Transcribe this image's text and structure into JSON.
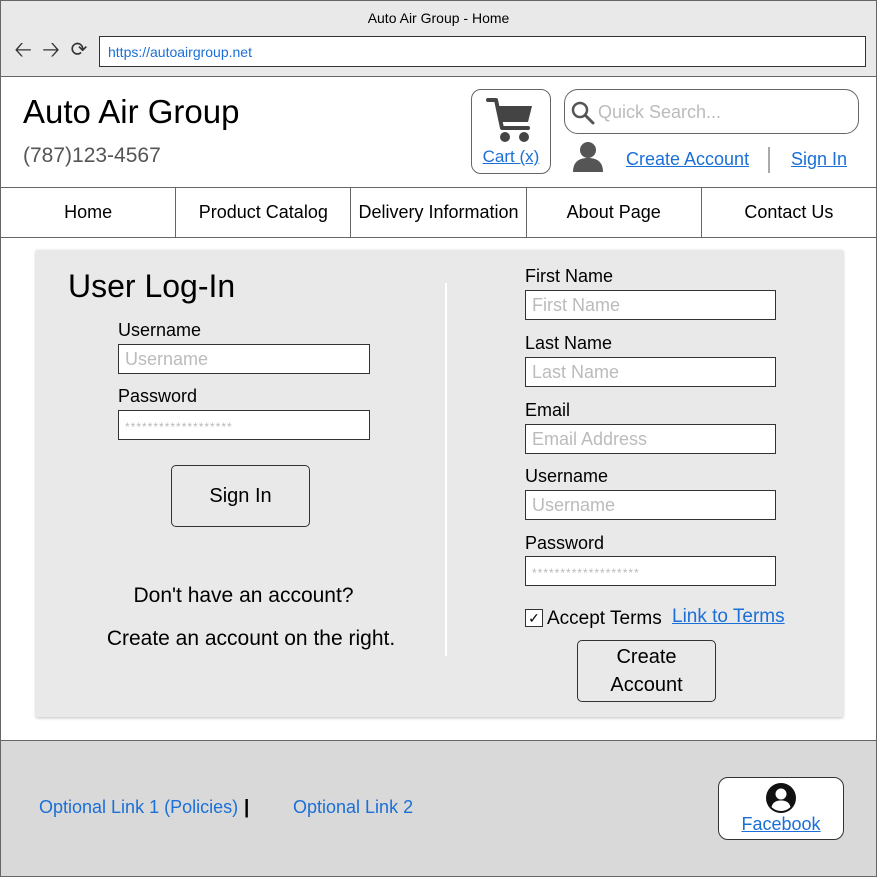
{
  "browser": {
    "title": "Auto Air Group - Home",
    "url": "https://autoairgroup.net",
    "back_icon": "arrow-left-icon",
    "forward_icon": "arrow-right-icon",
    "reload_icon": "reload-icon"
  },
  "header": {
    "brand": "Auto Air Group",
    "phone": "(787)123-4567",
    "cart_label": "Cart (x)",
    "search_placeholder": "Quick Search...",
    "create_account_link": "Create Account",
    "sign_in_link": "Sign In"
  },
  "nav": {
    "items": [
      "Home",
      "Product Catalog",
      "Delivery Information",
      "About Page",
      "Contact Us"
    ]
  },
  "login": {
    "title": "User Log-In",
    "username_label": "Username",
    "username_placeholder": "Username",
    "password_label": "Password",
    "password_placeholder": "*******************",
    "sign_in_button": "Sign In",
    "no_account_text": "Don't have an account?",
    "create_hint_text": "Create an account on the right."
  },
  "register": {
    "first_name_label": "First Name",
    "first_name_placeholder": "First Name",
    "last_name_label": "Last Name",
    "last_name_placeholder": "Last Name",
    "email_label": "Email",
    "email_placeholder": "Email Address",
    "username_label": "Username",
    "username_placeholder": "Username",
    "password_label": "Password",
    "password_placeholder": "*******************",
    "accept_terms_label": "Accept Terms",
    "accept_terms_checked": true,
    "terms_link": "Link to Terms",
    "create_button": "Create Account"
  },
  "footer": {
    "link1": "Optional Link 1 (Policies)",
    "separator": "|",
    "link2": "Optional Link 2",
    "facebook_label": "Facebook"
  },
  "colors": {
    "link": "#1a6fd8",
    "panel_bg": "#e9e9e9",
    "footer_bg": "#d9d9d9"
  }
}
